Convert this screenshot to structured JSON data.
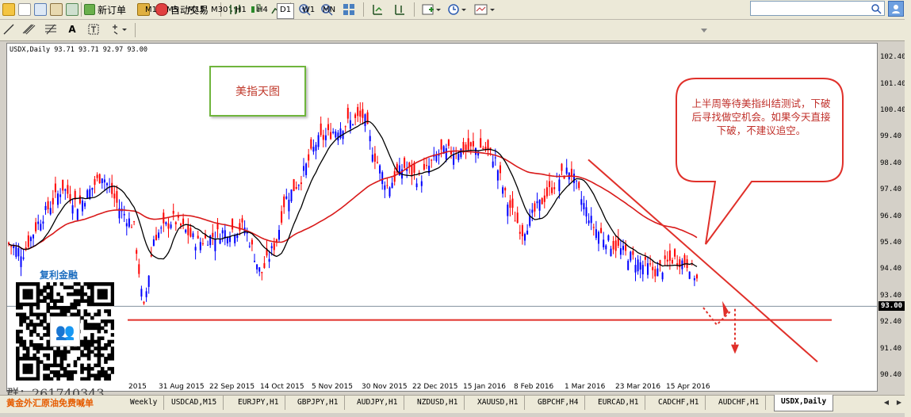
{
  "toolbar": {
    "new_order_label": "新订单",
    "auto_trade_label": "自动交易"
  },
  "timeframes": [
    "M1",
    "M5",
    "M15",
    "M30",
    "H1",
    "H4",
    "D1",
    "W1",
    "MN"
  ],
  "active_timeframe": "D1",
  "chart_data": {
    "type": "candlestick",
    "symbol_info": "USDX,Daily  93.71 93.71 92.97 93.00",
    "y_ticks": [
      "102.40",
      "101.40",
      "100.40",
      "99.40",
      "98.40",
      "97.40",
      "96.40",
      "95.40",
      "94.40",
      "93.40",
      "92.40",
      "91.40",
      "90.40"
    ],
    "current_price": "93.00",
    "x_ticks": [
      "2015",
      "31 Aug 2015",
      "22 Sep 2015",
      "14 Oct 2015",
      "5 Nov 2015",
      "30 Nov 2015",
      "22 Dec 2015",
      "15 Jan 2016",
      "8 Feb 2016",
      "1 Mar 2016",
      "23 Mar 2016",
      "15 Apr 2016"
    ],
    "ylim": [
      90.2,
      102.7
    ],
    "colors": {
      "up": "#0000ff",
      "down": "#ff0000",
      "ma_fast": "#000000",
      "ma_slow": "#d91a1a",
      "annotation": "#e0302a"
    }
  },
  "annotations": {
    "title_box": "美指天图",
    "callout": "上半周等待美指纠结测试，下破后寻找做空机会。如果今天直接下破，不建议追空。"
  },
  "promo": {
    "qr_title": "复利金融",
    "group": "群：261740343",
    "slogan": "黄金外汇原油免费喊单"
  },
  "tabs": [
    "Weekly",
    "USDCAD,M15",
    "EURJPY,H1",
    "GBPJPY,H1",
    "AUDJPY,H1",
    "NZDUSD,H1",
    "XAUUSD,H1",
    "GBPCHF,H4",
    "EURCAD,H1",
    "CADCHF,H1",
    "AUDCHF,H1",
    "USDX,Daily"
  ],
  "active_tab": "USDX,Daily"
}
